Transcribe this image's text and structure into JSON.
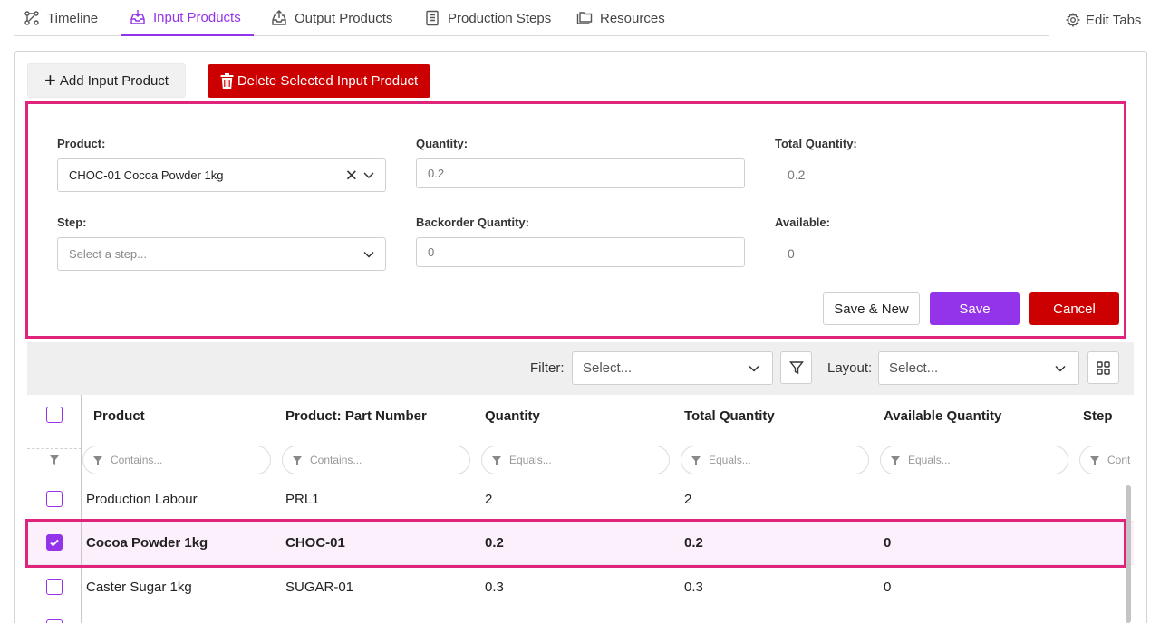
{
  "tabs": [
    {
      "label": "Timeline",
      "icon": "timeline-icon"
    },
    {
      "label": "Input Products",
      "icon": "input-tray-icon"
    },
    {
      "label": "Output Products",
      "icon": "output-tray-icon"
    },
    {
      "label": "Production Steps",
      "icon": "document-list-icon"
    },
    {
      "label": "Resources",
      "icon": "folders-icon"
    }
  ],
  "active_tab": "Input Products",
  "edit_tabs_label": "Edit Tabs",
  "actions": {
    "add_label": "Add Input Product",
    "delete_label": "Delete Selected Input Product"
  },
  "form": {
    "product_label": "Product:",
    "product_value": "CHOC-01 Cocoa Powder 1kg",
    "quantity_label": "Quantity:",
    "quantity_value": "0.2",
    "total_quantity_label": "Total Quantity:",
    "total_quantity_value": "0.2",
    "step_label": "Step:",
    "step_placeholder": "Select a step...",
    "backorder_label": "Backorder Quantity:",
    "backorder_value": "0",
    "available_label": "Available:",
    "available_value": "0",
    "save_new_label": "Save & New",
    "save_label": "Save",
    "cancel_label": "Cancel"
  },
  "toolbar": {
    "filter_label": "Filter:",
    "filter_placeholder": "Select...",
    "layout_label": "Layout:",
    "layout_placeholder": "Select..."
  },
  "grid": {
    "columns": [
      "Product",
      "Product: Part Number",
      "Quantity",
      "Total Quantity",
      "Available Quantity",
      "Step"
    ],
    "filters": [
      "Contains...",
      "Contains...",
      "Equals...",
      "Equals...",
      "Equals...",
      "Cont"
    ],
    "rows": [
      {
        "checked": false,
        "product": "Production Labour",
        "part": "PRL1",
        "quantity": "2",
        "total": "2",
        "available": "",
        "step": ""
      },
      {
        "checked": true,
        "product": "Cocoa Powder 1kg",
        "part": "CHOC-01",
        "quantity": "0.2",
        "total": "0.2",
        "available": "0",
        "step": ""
      },
      {
        "checked": false,
        "product": "Caster Sugar 1kg",
        "part": "SUGAR-01",
        "quantity": "0.3",
        "total": "0.3",
        "available": "0",
        "step": ""
      }
    ]
  },
  "colors": {
    "accent": "#9333ea",
    "danger": "#cc0000",
    "highlight": "#e0247b"
  }
}
